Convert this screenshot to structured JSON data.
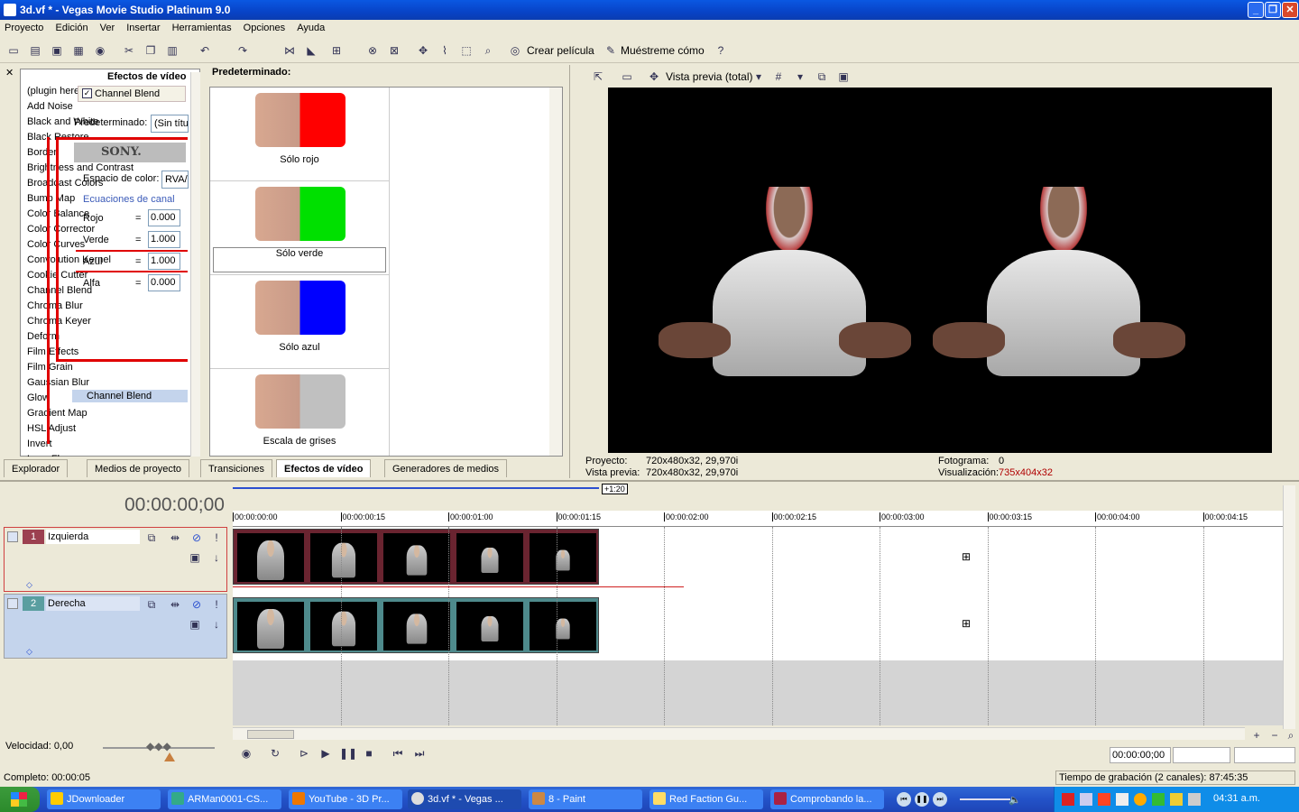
{
  "window": {
    "title": "3d.vf * - Vegas Movie Studio Platinum 9.0"
  },
  "menu": [
    "Proyecto",
    "Edición",
    "Ver",
    "Insertar",
    "Herramientas",
    "Opciones",
    "Ayuda"
  ],
  "toolbar": {
    "make_movie": "Crear película",
    "show_me": "Muéstreme cómo"
  },
  "left_panel": {
    "fx_header": "Efectos de vídeo",
    "preset_header": "Predeterminado:",
    "fx_items": [
      "(plugin heredado) Broadcast Colors",
      "Add Noise",
      "Black and White",
      "Black Restore",
      "Border",
      "Brightness and Contrast",
      "Broadcast Colors",
      "Bump Map",
      "Color Balance",
      "Color Corrector",
      "Color Curves",
      "Convolution Kernel",
      "Cookie Cutter",
      "Channel Blend",
      "Chroma Blur",
      "Chroma Keyer",
      "Deform",
      "Film Effects",
      "Film Grain",
      "Gaussian Blur",
      "Glow",
      "Gradient Map",
      "HSL Adjust",
      "Invert",
      "Lens Flare"
    ],
    "presets": [
      {
        "label": "Sólo rojo",
        "color": "#ff0000"
      },
      {
        "label": "Sólo verde",
        "color": "#00e000"
      },
      {
        "label": "Sólo azul",
        "color": "#0000ff"
      },
      {
        "label": "Escala de grises",
        "color": "#c0c0c0"
      }
    ],
    "overlay": {
      "checkbox_label": "Channel Blend",
      "preset_label": "Predeterminado:",
      "preset_value": "(Sin títu",
      "colorspace_label": "Espacio de color:",
      "colorspace_value": "RVA/",
      "equations_label": "Ecuaciones de canal",
      "rojo_label": "Rojo",
      "rojo": "0.000",
      "verde_label": "Verde",
      "verde": "1.000",
      "azul_label": "Azul",
      "azul": "1.000",
      "alfa_label": "Alfa",
      "alfa": "0.000",
      "chain_label": "Channel Blend",
      "sony": "SONY."
    },
    "tabs": [
      "Explorador",
      "Medios de proyecto",
      "Transiciones",
      "Efectos de vídeo",
      "Generadores de medios"
    ]
  },
  "preview": {
    "mode": "Vista previa (total)",
    "proyecto_label": "Proyecto:",
    "proyecto": "720x480x32, 29,970i",
    "vista_label": "Vista previa:",
    "vista": "720x480x32, 29,970i",
    "fotograma_label": "Fotograma:",
    "fotograma": "0",
    "visualizacion_label": "Visualización:",
    "visualizacion": "735x404x32"
  },
  "timeline": {
    "timecode": "00:00:00;00",
    "marker": "+1:20",
    "ruler": [
      "00:00:00:00",
      "00:00:00:15",
      "00:00:01:00",
      "00:00:01:15",
      "00:00:02:00",
      "00:00:02:15",
      "00:00:03:00",
      "00:00:03:15",
      "00:00:04:00",
      "00:00:04:15"
    ],
    "tracks": [
      {
        "num": "1",
        "name": "Izquierda",
        "color": "#9c4050"
      },
      {
        "num": "2",
        "name": "Derecha",
        "color": "#5a9ea0"
      }
    ],
    "speed": "Velocidad: 0,00",
    "time_display": "00:00:00;00"
  },
  "status": {
    "left": "Completo: 00:00:05",
    "right": "Tiempo de grabación (2 canales): 87:45:35"
  },
  "taskbar": {
    "items": [
      "JDownloader",
      "ARMan0001-CS...",
      "YouTube - 3D Pr...",
      "3d.vf * - Vegas ...",
      "8 - Paint",
      "Red Faction Gu...",
      "Comprobando la..."
    ],
    "clock": "04:31 a.m."
  }
}
